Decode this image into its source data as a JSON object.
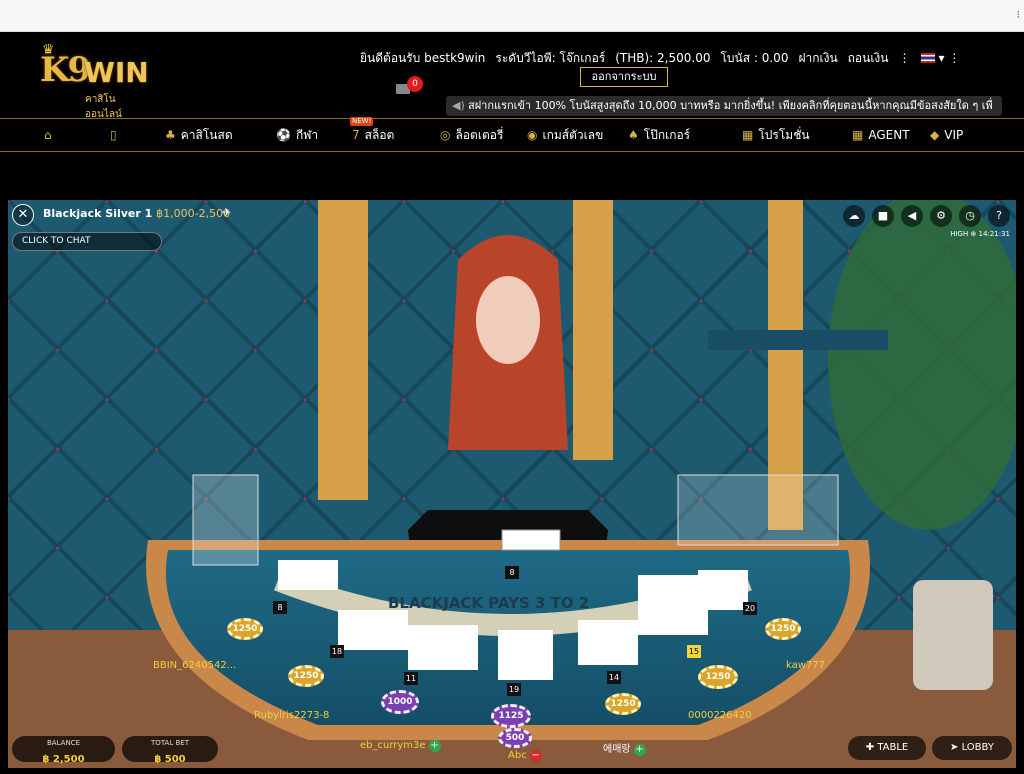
{
  "header": {
    "logo_text": "K9WIN",
    "logo_sub": "คาสิโน ออนไลน์",
    "welcome": "ยินดีต้อนรับ bestk9win",
    "vip_level": "ระดับวีไอพี: โจ๊กเกอร์",
    "balance": "(THB): 2,500.00",
    "bonus": "โบนัส : 0.00",
    "deposit": "ฝากเงิน",
    "withdraw": "ถอนเงิน",
    "logout": "ออกจากระบบ",
    "mail_count": "0",
    "marquee": "สฝากแรกเข้า 100% โบนัสสูงสุดถึง 10,000 บาทหรือ มากยิ่งขึ้น! เพียงคลิกที่คุยตอนนี้หากคุณมีข้อสงสัยใด ๆ เพื่"
  },
  "nav": {
    "items": [
      {
        "label": "",
        "icon": "home-icon"
      },
      {
        "label": "",
        "icon": "mobile-icon"
      },
      {
        "label": "คาสิโนสด",
        "icon": "casino-icon"
      },
      {
        "label": "กีฬา",
        "icon": "soccer-ball-icon"
      },
      {
        "label": "สล็อต",
        "icon": "slot-icon",
        "badge": "NEW!"
      },
      {
        "label": "ล็อตเตอรี่",
        "icon": "lottery-icon"
      },
      {
        "label": "เกมส์ตัวเลข",
        "icon": "number-game-icon"
      },
      {
        "label": "โป๊กเกอร์",
        "icon": "poker-icon"
      },
      {
        "label": "โปรโมชั่น",
        "icon": "promotion-icon"
      },
      {
        "label": "AGENT",
        "icon": "agent-icon"
      },
      {
        "label": "VIP",
        "icon": "diamond-icon"
      }
    ]
  },
  "game": {
    "table_name": "Blackjack Silver 1",
    "limits": "฿1,000-2,500",
    "chat_button": "CLICK TO CHAT",
    "clock": "HIGH  ⊕ 14:21:31",
    "table_felt_text": "BLACKJACK PAYS 3 TO 2",
    "dealer_score": "8",
    "seats": [
      {
        "name": "BBIN_6240542...",
        "score": "8"
      },
      {
        "name": "Rubylris2273-8",
        "score": "18"
      },
      {
        "name": "eb_currym3e",
        "score": "11"
      },
      {
        "name": "Abc",
        "score": "19"
      },
      {
        "name": "에매랑",
        "score": "14"
      },
      {
        "name": "0000226420",
        "score": "15"
      },
      {
        "name": "kaw777",
        "score": "20"
      }
    ],
    "chips": [
      "1250",
      "1250",
      "1000",
      "1125",
      "500",
      "1250",
      "1250",
      "1250"
    ],
    "balance_label": "BALANCE",
    "balance_value": "฿ 2,500",
    "total_bet_label": "TOTAL BET",
    "total_bet_value": "฿ 500",
    "table_button": "TABLE",
    "lobby_button": "LOBBY"
  }
}
